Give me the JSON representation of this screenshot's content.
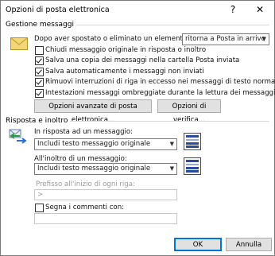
{
  "window": {
    "title": "Opzioni di posta elettronica",
    "help_label": "?",
    "close_label": "✕"
  },
  "message_handling": {
    "section_label": "Gestione messaggi",
    "after_move_label": "Dopo aver spostato o eliminato un elemento aperto:",
    "after_move_value": "ritorna a Posta in arrivo",
    "options": [
      {
        "label": "Chiudi messaggio originale in risposta o inoltro",
        "checked": false
      },
      {
        "label": "Salva una copia dei messaggi nella cartella Posta inviata",
        "checked": true
      },
      {
        "label": "Salva automaticamente i messaggi non inviati",
        "checked": true
      },
      {
        "label": "Rimuovi interruzioni di riga in eccesso nei messaggi di testo normale",
        "checked": true
      },
      {
        "label": "Intestazioni messaggi ombreggiate durante la lettura dei messaggi",
        "checked": true
      }
    ],
    "advanced_button": "Opzioni avanzate di posta elettronica...",
    "tracking_button": "Opzioni di verifica..."
  },
  "replies": {
    "section_label": "Risposta e inoltro",
    "reply_label": "In risposta ad un messaggio:",
    "reply_value": "Includi testo messaggio originale",
    "forward_label": "All'inoltro di un messaggio:",
    "forward_value": "Includi testo messaggio originale",
    "prefix_label": "Prefisso all'inizio di ogni riga:",
    "prefix_value": ">",
    "comments_label": "Segna i commenti con:",
    "comments_checked": false,
    "comments_value": ""
  },
  "footer": {
    "ok_label": "OK",
    "cancel_label": "Annulla"
  },
  "icons": {
    "envelope": "envelope-icon",
    "reply_forward": "reply-forward-icon",
    "preview": "message-preview-icon"
  }
}
